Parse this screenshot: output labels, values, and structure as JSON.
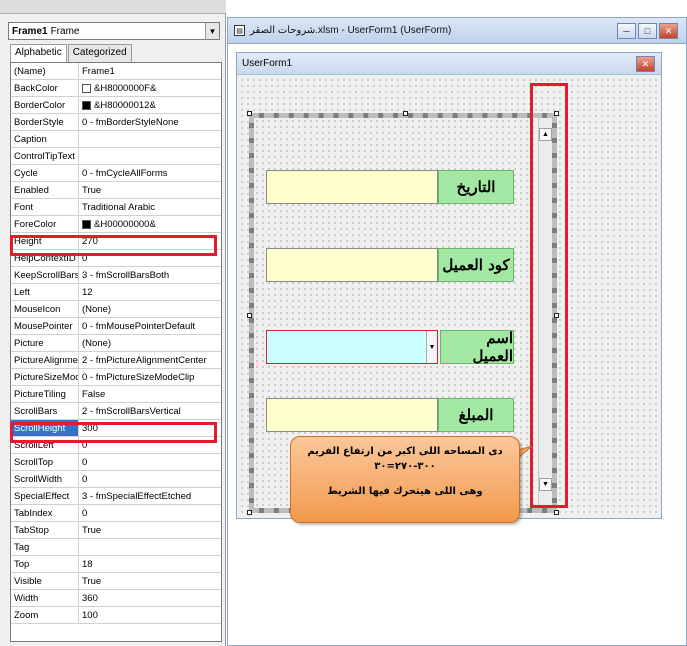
{
  "properties_panel": {
    "object_name": "Frame1",
    "object_type": "Frame",
    "tabs": [
      "Alphabetic",
      "Categorized"
    ],
    "active_tab": "Alphabetic",
    "rows": [
      {
        "name": "(Name)",
        "value": "Frame1"
      },
      {
        "name": "BackColor",
        "value": "&H8000000F&",
        "swatch": "#ffffff"
      },
      {
        "name": "BorderColor",
        "value": "&H80000012&",
        "swatch": "#000000"
      },
      {
        "name": "BorderStyle",
        "value": "0 - fmBorderStyleNone"
      },
      {
        "name": "Caption",
        "value": ""
      },
      {
        "name": "ControlTipText",
        "value": ""
      },
      {
        "name": "Cycle",
        "value": "0 - fmCycleAllForms"
      },
      {
        "name": "Enabled",
        "value": "True"
      },
      {
        "name": "Font",
        "value": "Traditional Arabic"
      },
      {
        "name": "ForeColor",
        "value": "&H00000000&",
        "swatch": "#000000"
      },
      {
        "name": "Height",
        "value": "270"
      },
      {
        "name": "HelpContextID",
        "value": "0"
      },
      {
        "name": "KeepScrollBarsVisible",
        "value": "3 - fmScrollBarsBoth"
      },
      {
        "name": "Left",
        "value": "12"
      },
      {
        "name": "MouseIcon",
        "value": "(None)"
      },
      {
        "name": "MousePointer",
        "value": "0 - fmMousePointerDefault"
      },
      {
        "name": "Picture",
        "value": "(None)"
      },
      {
        "name": "PictureAlignment",
        "value": "2 - fmPictureAlignmentCenter"
      },
      {
        "name": "PictureSizeMode",
        "value": "0 - fmPictureSizeModeClip"
      },
      {
        "name": "PictureTiling",
        "value": "False"
      },
      {
        "name": "ScrollBars",
        "value": "2 - fmScrollBarsVertical"
      },
      {
        "name": "ScrollHeight",
        "value": "300"
      },
      {
        "name": "ScrollLeft",
        "value": "0"
      },
      {
        "name": "ScrollTop",
        "value": "0"
      },
      {
        "name": "ScrollWidth",
        "value": "0"
      },
      {
        "name": "SpecialEffect",
        "value": "3 - fmSpecialEffectEtched"
      },
      {
        "name": "TabIndex",
        "value": "0"
      },
      {
        "name": "TabStop",
        "value": "True"
      },
      {
        "name": "Tag",
        "value": ""
      },
      {
        "name": "Top",
        "value": "18"
      },
      {
        "name": "Visible",
        "value": "True"
      },
      {
        "name": "Width",
        "value": "360"
      },
      {
        "name": "Zoom",
        "value": "100"
      }
    ],
    "selected_row": "ScrollHeight",
    "highlight_color": "#e21b2d"
  },
  "designer": {
    "window_title": "شروحات الصقر.xlsm - UserForm1 (UserForm)",
    "window_buttons": [
      "─",
      "□",
      "✕"
    ],
    "userform_title": "UserForm1",
    "close_glyph": "✕",
    "scroll_up_glyph": "▲",
    "scroll_down_glyph": "▼",
    "combo_arrow_glyph": "▼",
    "labels": [
      "التاريخ",
      "كود العميل",
      "اسم العميل",
      "المبلغ"
    ],
    "field_color": "#ffffcc",
    "combo_color": "#ccffff",
    "label_color": "#a2e8a2"
  },
  "callout": {
    "line1": "دى المساحه اللى اكبر من ارتفاع الفريم",
    "line2": "٣٠٠-٢٧٠=٣٠",
    "line3": "وهى اللى هيتحرك فيها الشريط",
    "color": "#f29a4e"
  }
}
